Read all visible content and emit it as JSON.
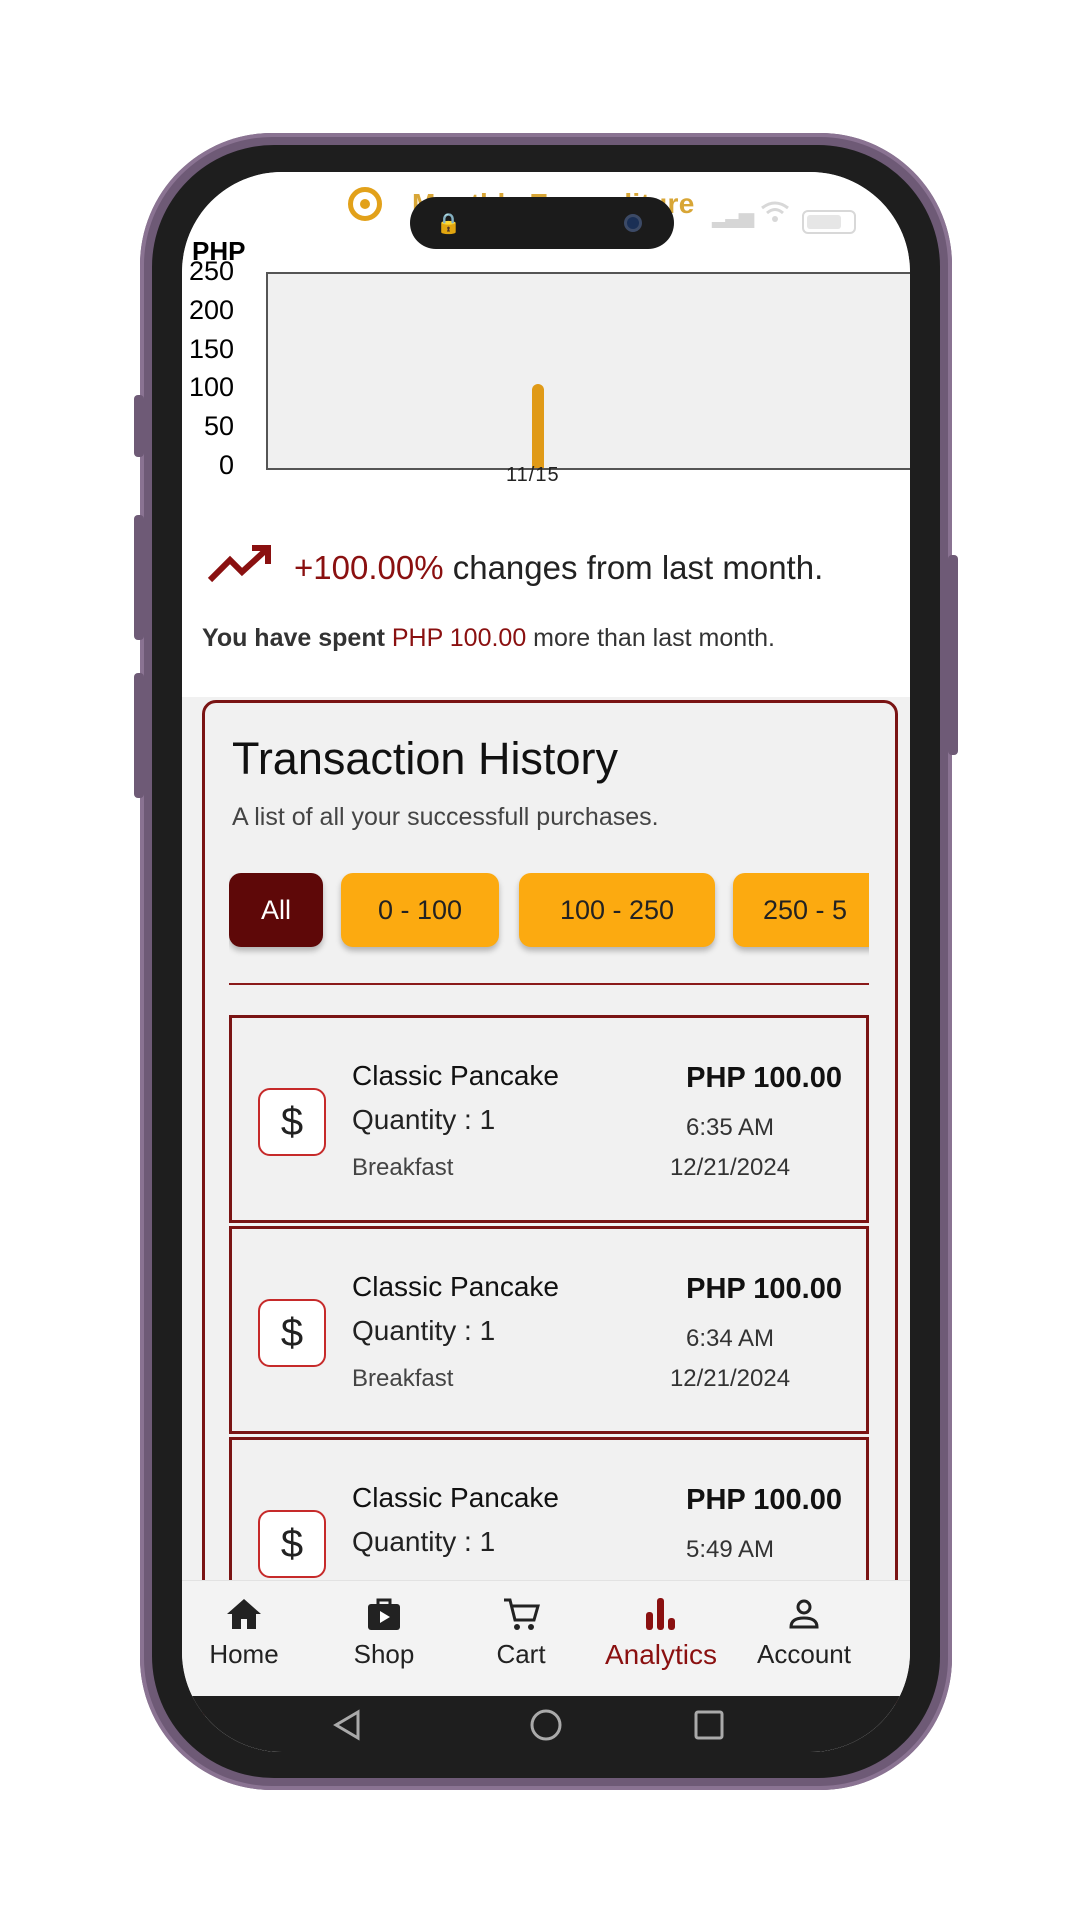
{
  "header": {
    "legend_label": "Monthly Expenditure"
  },
  "chart_data": {
    "type": "bar",
    "categories": [
      "11/15"
    ],
    "values": [
      108
    ],
    "title": "",
    "xlabel": "",
    "ylabel": "PHP",
    "ylim": [
      0,
      250
    ],
    "yticks": [
      "250",
      "200",
      "150",
      "100",
      "50",
      "0"
    ],
    "bar_color": "#e09a17",
    "grid": false
  },
  "change": {
    "percent": "+100.00%",
    "text": " changes from last month."
  },
  "spent": {
    "prefix": "You have spent ",
    "amount": "PHP 100.00",
    "suffix": " more than last month."
  },
  "transactions": {
    "title": "Transaction History",
    "subtitle": "A list of all your successfull purchases.",
    "filters": [
      "All",
      "0 - 100",
      "100 - 250",
      "250 - 5"
    ],
    "items": [
      {
        "name": "Classic Pancake",
        "quantity": "Quantity : 1",
        "category": "Breakfast",
        "price": "PHP 100.00",
        "time": "6:35 AM",
        "date": "12/21/2024",
        "icon": "$"
      },
      {
        "name": "Classic Pancake",
        "quantity": "Quantity : 1",
        "category": "Breakfast",
        "price": "PHP 100.00",
        "time": "6:34 AM",
        "date": "12/21/2024",
        "icon": "$"
      },
      {
        "name": "Classic Pancake",
        "quantity": "Quantity : 1",
        "category": "",
        "price": "PHP 100.00",
        "time": "5:49 AM",
        "date": "",
        "icon": "$"
      }
    ]
  },
  "nav": {
    "items": [
      {
        "label": "Home",
        "icon": "home-icon"
      },
      {
        "label": "Shop",
        "icon": "shopping-bag-icon"
      },
      {
        "label": "Cart",
        "icon": "cart-icon"
      },
      {
        "label": "Analytics",
        "icon": "bar-chart-icon"
      },
      {
        "label": "Account",
        "icon": "account-icon"
      }
    ],
    "active": "Analytics"
  },
  "colors": {
    "accent": "#8a1010",
    "chip_active": "#5e0808",
    "chip": "#fcaa10",
    "bar": "#e09a17"
  }
}
